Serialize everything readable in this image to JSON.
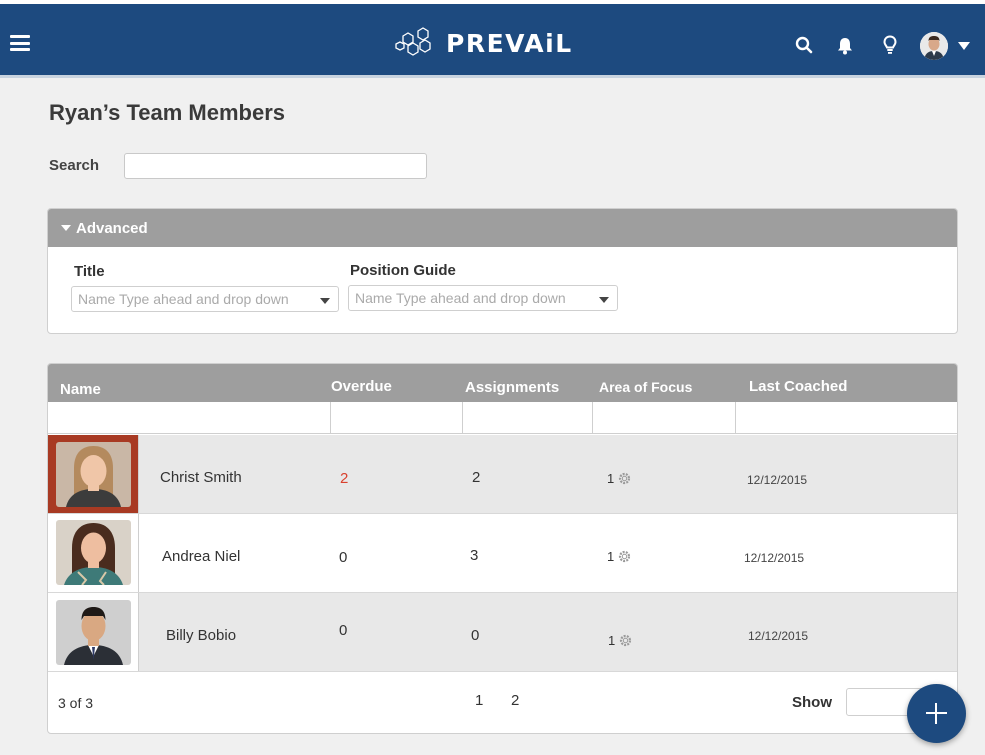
{
  "header": {
    "brand": "PREVAiL",
    "icons": [
      "hamburger-menu-icon",
      "search-icon",
      "bell-icon",
      "lightbulb-icon",
      "user-avatar",
      "chevron-down-icon"
    ]
  },
  "page": {
    "title": "Ryan’s Team Members",
    "search_label": "Search",
    "search_value": ""
  },
  "advanced": {
    "label": "Advanced",
    "title_label": "Title",
    "title_placeholder": "Name Type ahead and drop down",
    "position_label": "Position Guide",
    "position_placeholder": "Name Type ahead and drop down"
  },
  "table": {
    "columns": [
      "Name",
      "Overdue",
      "Assignments",
      "Area of Focus",
      "Last Coached"
    ],
    "rows": [
      {
        "name": "Christ Smith",
        "overdue": "2",
        "assignments": "2",
        "focus": "1",
        "last_coached": "12/12/2015",
        "selected": true
      },
      {
        "name": "Andrea Niel",
        "overdue": "0",
        "assignments": "3",
        "focus": "1",
        "last_coached": "12/12/2015",
        "selected": false
      },
      {
        "name": "Billy Bobio",
        "overdue": "0",
        "assignments": "0",
        "focus": "1",
        "last_coached": "12/12/2015",
        "selected": false
      }
    ],
    "footer": {
      "count": "3 of 3",
      "pages": [
        "1",
        "2"
      ],
      "show_label": "Show",
      "show_value": ""
    }
  },
  "colors": {
    "header_bg": "#1d4a7f",
    "panel_header": "#9e9e9e",
    "overdue_red": "#d9412e",
    "selected_photo_bg": "#a83a23"
  }
}
